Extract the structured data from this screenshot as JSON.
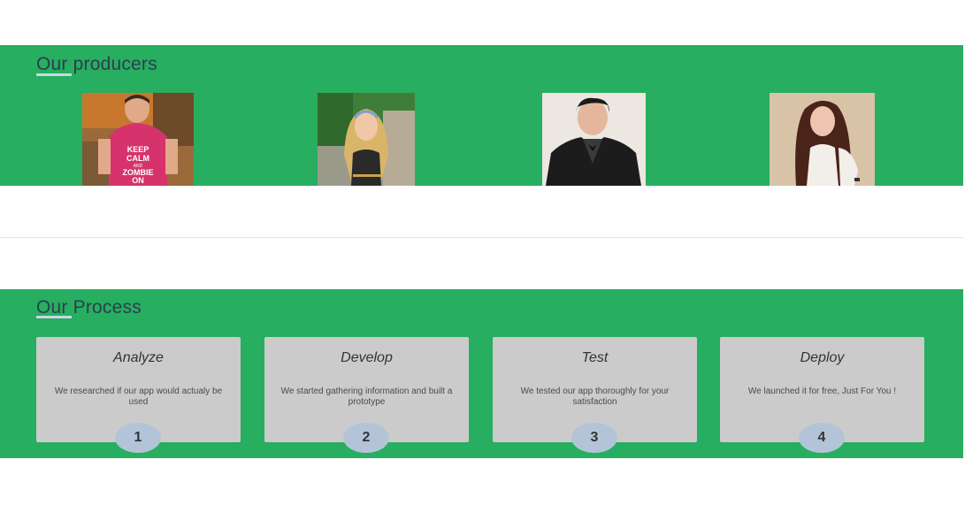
{
  "producers": {
    "title": "Our producers",
    "people": [
      {
        "photo": "person-photo",
        "shirt_text": [
          "KEEP",
          "CALM",
          "AND",
          "ZOMBIE",
          "ON"
        ]
      },
      {
        "photo": "person-photo"
      },
      {
        "photo": "person-photo"
      },
      {
        "photo": "person-photo"
      }
    ]
  },
  "process": {
    "title": "Our Process",
    "steps": [
      {
        "title": "Analyze",
        "text": "We researched if our app would actualy be used",
        "number": "1"
      },
      {
        "title": "Develop",
        "text": "We started gathering information and built a prototype",
        "number": "2"
      },
      {
        "title": "Test",
        "text": "We tested our app thoroughly for your satisfaction",
        "number": "3"
      },
      {
        "title": "Deploy",
        "text": "We launched it for free, Just For You !",
        "number": "4"
      }
    ]
  },
  "colors": {
    "band": "#27ae60",
    "card": "#cbcbcb",
    "step_circle": "#b3c4d9",
    "heading": "#2c3e50"
  }
}
